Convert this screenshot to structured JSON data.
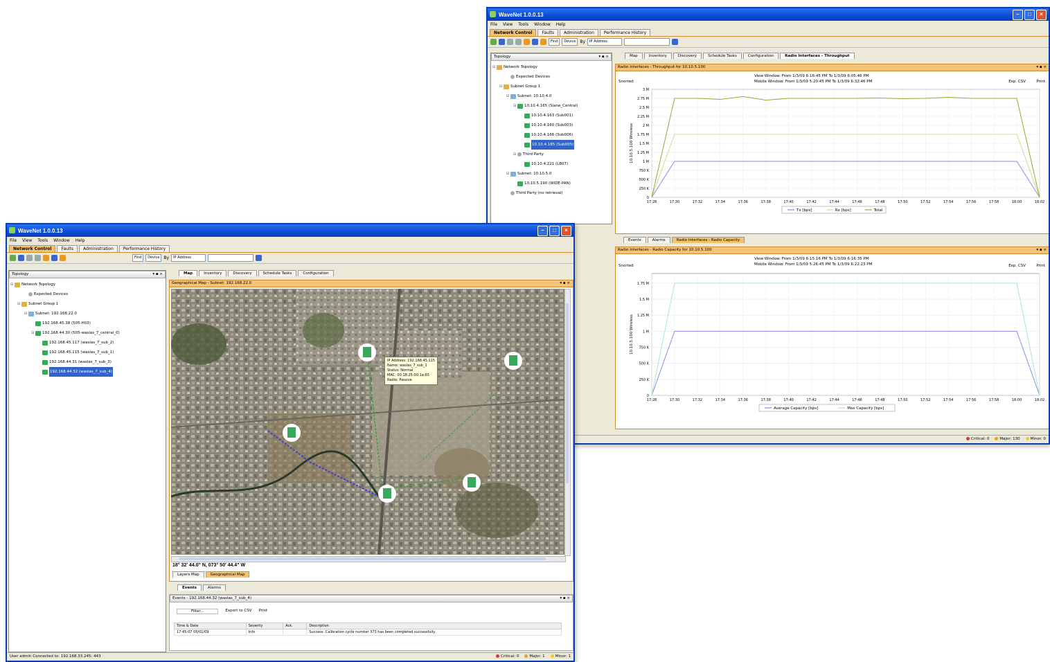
{
  "back_window": {
    "title": "WaveNet 1.0.0.13",
    "menu": [
      "File",
      "View",
      "Tools",
      "Window",
      "Help"
    ],
    "top_tabs": [
      "Network Control",
      "Faults",
      "Administration",
      "Performance History"
    ],
    "toolbar": {
      "find_label": "Find",
      "find_type": "Device",
      "by_label": "By",
      "by_value": "IP Address"
    },
    "topology": {
      "header": "Topology",
      "items": [
        "Network Topology",
        "Expected Devices",
        "Subnet Group 1",
        "Subnet: 10.10.4.0",
        "10.10.4.165 (Siane_Central)",
        "10.10.4.163 (Sub001)",
        "10.10.4.160 (Sub003)",
        "10.10.4.166 (Sub006)",
        "10.10.4.185 (Sub005)",
        "Third Party",
        "10.10.4.221 (LB07)",
        "Subnet: 10.10.5.0",
        "10.10.5.190 (WIDE-PAN)",
        "Third Party (no retrieval)"
      ]
    },
    "view_tabs": [
      "Map",
      "Inventory",
      "Discovery",
      "Schedule Tasks",
      "Configuration",
      "Radio Interfaces - Throughput"
    ],
    "throughput": {
      "header": "Radio Interfaces - Throughput for 10.10.5.100",
      "sync_label": "Snorted",
      "view_window": "View Window: From 1/3/09 6:16:45 PM To 1/3/09 6:05:46 PM",
      "mobile_window": "Mobile Window: From 1/3/09 5:20:45 PM To 1/3/09 6:32:46 PM",
      "export": "Exp. CSV",
      "print": "Print",
      "ylabel": "10.10.5.100 Wireless"
    },
    "bottom_tabs": [
      "Events",
      "Alarms",
      "Radio Interfaces - Radio Capacity"
    ],
    "capacity": {
      "header": "Radio Interfaces - Radio Capacity for 10.10.5.100",
      "sync_label": "Snorted",
      "view_window": "View Window: From 1/3/09 6:15:16 PM To 1/3/09 6:16:35 PM",
      "mobile_window": "Mobile Window: From 1/3/09 5:26:45 PM To 1/3/09 6:22:23 PM",
      "export": "Exp. CSV",
      "print": "Print",
      "ylabel": "10.10.5.100 Wireless"
    },
    "status": {
      "critical": "Critical: 0",
      "major": "Major: 130",
      "minor": "Minor: 0"
    }
  },
  "front_window": {
    "title": "WaveNet 1.0.0.13",
    "menu": [
      "File",
      "View",
      "Tools",
      "Window",
      "Help"
    ],
    "top_tabs": [
      "Network Control",
      "Faults",
      "Administration",
      "Performance History"
    ],
    "toolbar": {
      "find_label": "Find",
      "find_type": "Device",
      "by_label": "By",
      "by_value": "IP Address"
    },
    "topology": {
      "header": "Topology",
      "items": [
        "Network Topology",
        "Expected Devices",
        "Subnet Group 1",
        "Subnet: 192.168.22.0",
        "192.168.45.38 (505-H03)",
        "192.168.44.30 (505-waslas_7_central_0)",
        "192.168.45.117 (waslas_7_sub_2)",
        "192.168.45.115 (waslas_7_sub_1)",
        "192.168.44.31 (waslas_7_sub_3)",
        "192.168.44.32 (waslas_7_sub_4)"
      ]
    },
    "view_tabs": [
      "Map",
      "Inventory",
      "Discovery",
      "Schedule Tasks",
      "Configuration"
    ],
    "map": {
      "header": "Geographical Map - Subnet: 192.168.22.0",
      "tooltip": {
        "line1": "IP Address: 192.168.45.115",
        "line2": "Name: waslas_7_sub_1",
        "line3": "Status: Normal",
        "line4": "MAC: 00:18:25:00:1a:65",
        "line5": "Radio: Passive"
      },
      "coordinates": "18° 32' 44.0\" N, 073° 50' 44.4\" W",
      "layers": [
        "Layers Map",
        "Geographical Map"
      ]
    },
    "bottom_tabs": [
      "Events",
      "Alarms"
    ],
    "events": {
      "header": "Events - 192.168.44.32 (waslas_7_sub_4)",
      "filter": "Filter...",
      "export": "Export to CSV",
      "print": "Print",
      "columns": [
        "Time & Date",
        "Severity",
        "Ack.",
        "Description"
      ],
      "rows": [
        [
          "17:45:07 05/01/09",
          "Info",
          "",
          "Success: Calibration cycle number 373 has been completed successfully."
        ]
      ]
    },
    "status": {
      "left": "User admin Connected to: 192.168.33.245: 443",
      "critical": "Critical: 0",
      "major": "Major: 1",
      "minor": "Minor: 1"
    }
  },
  "chart_data": [
    {
      "type": "line",
      "title": "Radio Interfaces - Throughput",
      "ylabel": "10.10.5.100 Wireless",
      "x": [
        "17:28",
        "17:30",
        "17:32",
        "17:34",
        "17:36",
        "17:38",
        "17:40",
        "17:42",
        "17:44",
        "17:46",
        "17:48",
        "17:50",
        "17:52",
        "17:54",
        "17:56",
        "17:58",
        "18:00",
        "18:02"
      ],
      "y_ticks": [
        "0",
        "250 K",
        "500 K",
        "750 K",
        "1 M",
        "1.25 M",
        "1.5 M",
        "1.75 M",
        "2 M",
        "2.25 M",
        "2.5 M",
        "2.75 M",
        "3 M"
      ],
      "ylim": [
        0,
        3000000
      ],
      "series": [
        {
          "name": "Tx [bps]",
          "values": [
            0,
            1000000,
            1000000,
            1000000,
            1000000,
            1000000,
            1000000,
            1000000,
            1000000,
            1000000,
            1000000,
            1000000,
            1000000,
            1000000,
            1000000,
            1000000,
            1000000,
            0
          ],
          "color": "#8a8ae6"
        },
        {
          "name": "Rx [bps]",
          "values": [
            0,
            1750000,
            1750000,
            1750000,
            1750000,
            1750000,
            1750000,
            1750000,
            1750000,
            1750000,
            1750000,
            1750000,
            1750000,
            1750000,
            1750000,
            1750000,
            1750000,
            0
          ],
          "color": "#c8e08a"
        },
        {
          "name": "Total",
          "values": [
            0,
            2750000,
            2750000,
            2720000,
            2800000,
            2700000,
            2750000,
            2750000,
            2750000,
            2750000,
            2760000,
            2740000,
            2750000,
            2780000,
            2750000,
            2750000,
            2750000,
            0
          ],
          "color": "#9aa832"
        }
      ],
      "grid": true,
      "legend": "bottom"
    },
    {
      "type": "line",
      "title": "Radio Interfaces - Radio Capacity",
      "ylabel": "10.10.5.100 Wireless",
      "x": [
        "17:28",
        "17:30",
        "17:32",
        "17:34",
        "17:36",
        "17:38",
        "17:40",
        "17:42",
        "17:44",
        "17:46",
        "17:48",
        "17:50",
        "17:52",
        "17:54",
        "17:56",
        "17:58",
        "18:00",
        "18:02"
      ],
      "y_ticks": [
        "0",
        "250 K",
        "500 K",
        "750 K",
        "1 M",
        "1.25 M",
        "1.5 M",
        "1.75 M"
      ],
      "ylim": [
        0,
        1900000
      ],
      "series": [
        {
          "name": "Average Capacity [bps]",
          "values": [
            0,
            1000000,
            1000000,
            1000000,
            1000000,
            1000000,
            1000000,
            1000000,
            1000000,
            1000000,
            1000000,
            1000000,
            1000000,
            1000000,
            1000000,
            1000000,
            1000000,
            0
          ],
          "color": "#8a8ae6"
        },
        {
          "name": "Max Capacity [bps]",
          "values": [
            0,
            1750000,
            1750000,
            1750000,
            1750000,
            1750000,
            1750000,
            1750000,
            1750000,
            1750000,
            1750000,
            1750000,
            1750000,
            1750000,
            1750000,
            1750000,
            1750000,
            0
          ],
          "color": "#a8e6d8"
        }
      ],
      "grid": true,
      "legend": "bottom"
    }
  ]
}
